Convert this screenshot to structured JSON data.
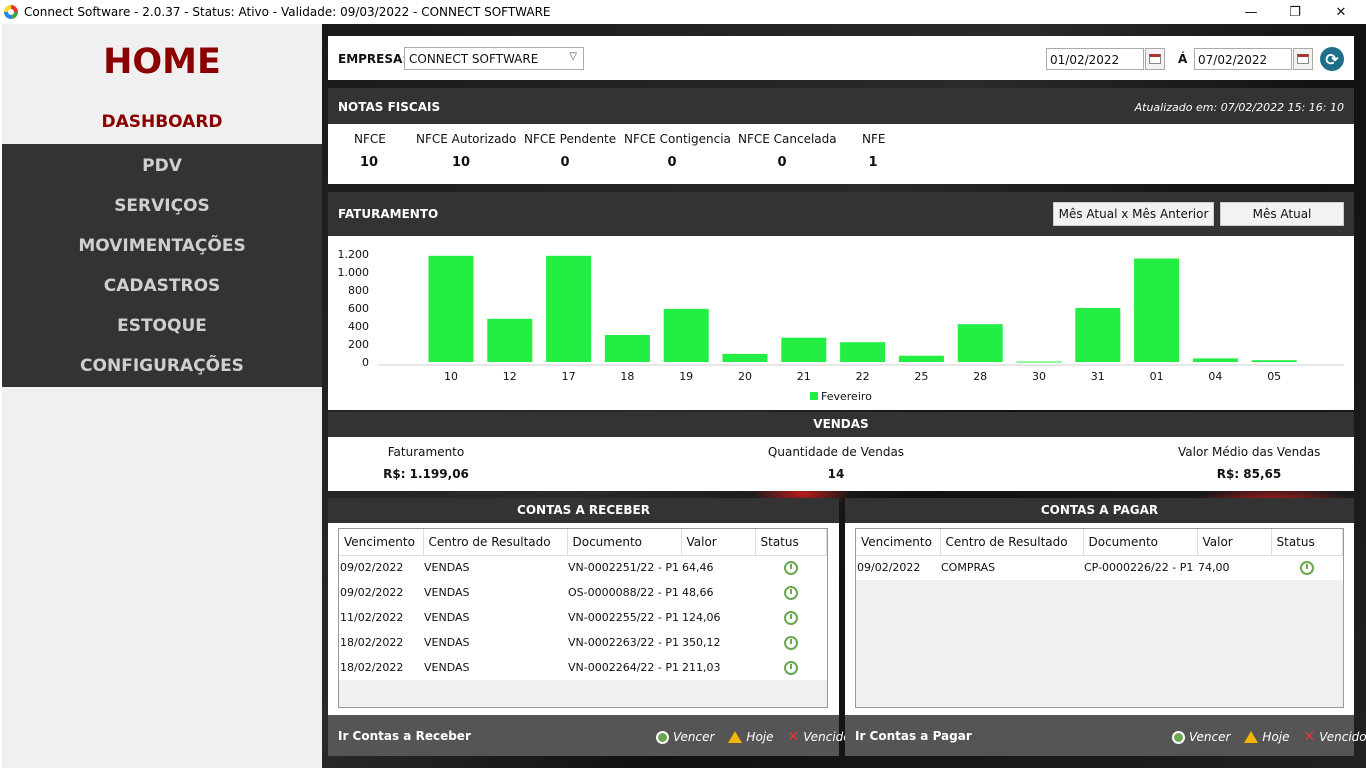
{
  "window": {
    "title": "Connect Software - 2.0.37 - Status: Ativo - Validade: 09/03/2022 - CONNECT SOFTWARE",
    "min": "—",
    "max": "❐",
    "close": "✕"
  },
  "sidebar": {
    "home": "HOME",
    "active": "DASHBOARD",
    "items": [
      {
        "label": "PDV"
      },
      {
        "label": "SERVIÇOS"
      },
      {
        "label": "MOVIMENTAÇÕES"
      },
      {
        "label": "CADASTROS"
      },
      {
        "label": "ESTOQUE"
      },
      {
        "label": "CONFIGURAÇÕES"
      }
    ]
  },
  "filters": {
    "empresa_label": "EMPRESA:",
    "empresa_value": "CONNECT SOFTWARE",
    "date_from": "01/02/2022",
    "a_label": "Á",
    "date_to": "07/02/2022"
  },
  "notas": {
    "title": "NOTAS FISCAIS",
    "updated": "Atualizado em: 07/02/2022 15: 16: 10",
    "items": [
      {
        "label": "NFCE",
        "value": "10"
      },
      {
        "label": "NFCE Autorizado",
        "value": "10"
      },
      {
        "label": "NFCE Pendente",
        "value": "0"
      },
      {
        "label": "NFCE Contigencia",
        "value": "0"
      },
      {
        "label": "NFCE Cancelada",
        "value": "0"
      },
      {
        "label": "NFE",
        "value": "1"
      }
    ]
  },
  "faturamento": {
    "title": "FATURAMENTO",
    "btn_compare": "Mês Atual x Mês Anterior",
    "btn_current": "Mês Atual"
  },
  "chart_data": {
    "type": "bar",
    "categories": [
      "10",
      "12",
      "17",
      "18",
      "19",
      "20",
      "21",
      "22",
      "25",
      "28",
      "30",
      "31",
      "01",
      "04",
      "05"
    ],
    "series": [
      {
        "name": "Fevereiro",
        "color": "#22ee44",
        "values": [
          1180,
          480,
          1180,
          300,
          590,
          90,
          270,
          220,
          70,
          420,
          5,
          600,
          1150,
          40,
          20
        ]
      }
    ],
    "ylim": [
      0,
      1200
    ],
    "yticks": [
      "0",
      "200",
      "400",
      "600",
      "800",
      "1.000",
      "1.200"
    ],
    "legend": "bottom-center",
    "grid": false
  },
  "vendas": {
    "title": "VENDAS",
    "faturamento_label": "Faturamento",
    "faturamento_value": "R$: 1.199,06",
    "quantidade_label": "Quantidade de Vendas",
    "quantidade_value": "14",
    "medio_label": "Valor Médio das Vendas",
    "medio_value": "R$: 85,65"
  },
  "receber": {
    "title": "CONTAS A RECEBER",
    "columns": [
      "Vencimento",
      "Centro de Resultado",
      "Documento",
      "Valor",
      "Status"
    ],
    "rows": [
      [
        "09/02/2022",
        "VENDAS",
        "VN-0002251/22 - P1",
        "64,46"
      ],
      [
        "09/02/2022",
        "VENDAS",
        "OS-0000088/22 - P1",
        "48,66"
      ],
      [
        "11/02/2022",
        "VENDAS",
        "VN-0002255/22 - P1",
        "124,06"
      ],
      [
        "18/02/2022",
        "VENDAS",
        "VN-0002263/22 - P1",
        "350,12"
      ],
      [
        "18/02/2022",
        "VENDAS",
        "VN-0002264/22 - P1",
        "211,03"
      ]
    ],
    "link": "Ir Contas a Receber"
  },
  "pagar": {
    "title": "CONTAS A PAGAR",
    "columns": [
      "Vencimento",
      "Centro de Resultado",
      "Documento",
      "Valor",
      "Status"
    ],
    "rows": [
      [
        "09/02/2022",
        "COMPRAS",
        "CP-0000226/22 - P1",
        "74,00"
      ]
    ],
    "link": "Ir Contas a Pagar"
  },
  "legend": {
    "vencer": "Vencer",
    "hoje": "Hoje",
    "vencido": "Vencido"
  }
}
